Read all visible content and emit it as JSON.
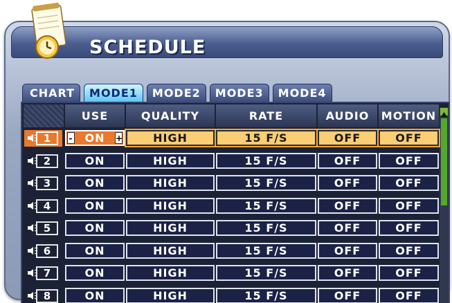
{
  "window": {
    "title": "SCHEDULE"
  },
  "tabs": [
    "CHART",
    "MODE1",
    "MODE2",
    "MODE3",
    "MODE4"
  ],
  "active_tab": "MODE1",
  "columns": [
    "USE",
    "QUALITY",
    "RATE",
    "AUDIO",
    "MOTION"
  ],
  "rows": [
    {
      "ch": "1",
      "use": "ON",
      "quality": "HIGH",
      "rate": "15 F/S",
      "audio": "OFF",
      "motion": "OFF"
    },
    {
      "ch": "2",
      "use": "ON",
      "quality": "HIGH",
      "rate": "15 F/S",
      "audio": "OFF",
      "motion": "OFF"
    },
    {
      "ch": "3",
      "use": "ON",
      "quality": "HIGH",
      "rate": "15 F/S",
      "audio": "OFF",
      "motion": "OFF"
    },
    {
      "ch": "4",
      "use": "ON",
      "quality": "HIGH",
      "rate": "15 F/S",
      "audio": "OFF",
      "motion": "OFF"
    },
    {
      "ch": "5",
      "use": "ON",
      "quality": "HIGH",
      "rate": "15 F/S",
      "audio": "OFF",
      "motion": "OFF"
    },
    {
      "ch": "6",
      "use": "ON",
      "quality": "HIGH",
      "rate": "15 F/S",
      "audio": "OFF",
      "motion": "OFF"
    },
    {
      "ch": "7",
      "use": "ON",
      "quality": "HIGH",
      "rate": "15 F/S",
      "audio": "OFF",
      "motion": "OFF"
    },
    {
      "ch": "8",
      "use": "ON",
      "quality": "HIGH",
      "rate": "15 F/S",
      "audio": "OFF",
      "motion": "OFF"
    }
  ],
  "selected_row": "1",
  "stepper": {
    "minus": "-",
    "plus": "+"
  },
  "icons": {
    "logo": "schedule-clock-notepad-icon",
    "speaker": "speaker-icon",
    "scroll_up": "scroll-up-icon",
    "scroll_down": "scroll-down-icon"
  },
  "colors": {
    "selected_row": "#fbcd75",
    "selected_use": "#e8792d",
    "active_tab": "#5ec7f2",
    "scrollbar": "#52a92c"
  }
}
